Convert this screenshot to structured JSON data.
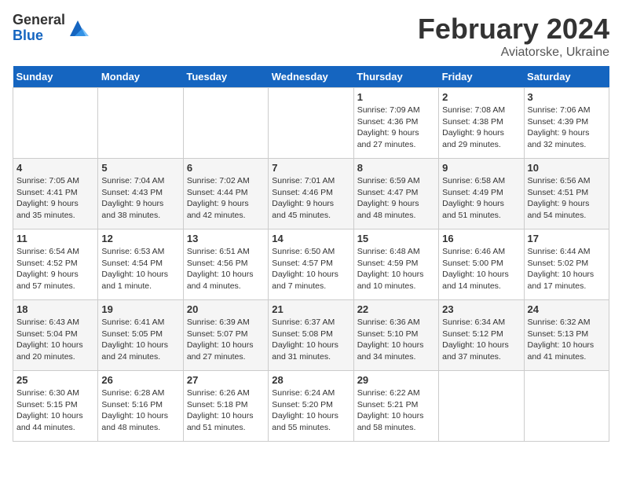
{
  "logo": {
    "general": "General",
    "blue": "Blue"
  },
  "header": {
    "title": "February 2024",
    "subtitle": "Aviatorske, Ukraine"
  },
  "weekdays": [
    "Sunday",
    "Monday",
    "Tuesday",
    "Wednesday",
    "Thursday",
    "Friday",
    "Saturday"
  ],
  "weeks": [
    [
      {
        "day": "",
        "info": ""
      },
      {
        "day": "",
        "info": ""
      },
      {
        "day": "",
        "info": ""
      },
      {
        "day": "",
        "info": ""
      },
      {
        "day": "1",
        "info": "Sunrise: 7:09 AM\nSunset: 4:36 PM\nDaylight: 9 hours\nand 27 minutes."
      },
      {
        "day": "2",
        "info": "Sunrise: 7:08 AM\nSunset: 4:38 PM\nDaylight: 9 hours\nand 29 minutes."
      },
      {
        "day": "3",
        "info": "Sunrise: 7:06 AM\nSunset: 4:39 PM\nDaylight: 9 hours\nand 32 minutes."
      }
    ],
    [
      {
        "day": "4",
        "info": "Sunrise: 7:05 AM\nSunset: 4:41 PM\nDaylight: 9 hours\nand 35 minutes."
      },
      {
        "day": "5",
        "info": "Sunrise: 7:04 AM\nSunset: 4:43 PM\nDaylight: 9 hours\nand 38 minutes."
      },
      {
        "day": "6",
        "info": "Sunrise: 7:02 AM\nSunset: 4:44 PM\nDaylight: 9 hours\nand 42 minutes."
      },
      {
        "day": "7",
        "info": "Sunrise: 7:01 AM\nSunset: 4:46 PM\nDaylight: 9 hours\nand 45 minutes."
      },
      {
        "day": "8",
        "info": "Sunrise: 6:59 AM\nSunset: 4:47 PM\nDaylight: 9 hours\nand 48 minutes."
      },
      {
        "day": "9",
        "info": "Sunrise: 6:58 AM\nSunset: 4:49 PM\nDaylight: 9 hours\nand 51 minutes."
      },
      {
        "day": "10",
        "info": "Sunrise: 6:56 AM\nSunset: 4:51 PM\nDaylight: 9 hours\nand 54 minutes."
      }
    ],
    [
      {
        "day": "11",
        "info": "Sunrise: 6:54 AM\nSunset: 4:52 PM\nDaylight: 9 hours\nand 57 minutes."
      },
      {
        "day": "12",
        "info": "Sunrise: 6:53 AM\nSunset: 4:54 PM\nDaylight: 10 hours\nand 1 minute."
      },
      {
        "day": "13",
        "info": "Sunrise: 6:51 AM\nSunset: 4:56 PM\nDaylight: 10 hours\nand 4 minutes."
      },
      {
        "day": "14",
        "info": "Sunrise: 6:50 AM\nSunset: 4:57 PM\nDaylight: 10 hours\nand 7 minutes."
      },
      {
        "day": "15",
        "info": "Sunrise: 6:48 AM\nSunset: 4:59 PM\nDaylight: 10 hours\nand 10 minutes."
      },
      {
        "day": "16",
        "info": "Sunrise: 6:46 AM\nSunset: 5:00 PM\nDaylight: 10 hours\nand 14 minutes."
      },
      {
        "day": "17",
        "info": "Sunrise: 6:44 AM\nSunset: 5:02 PM\nDaylight: 10 hours\nand 17 minutes."
      }
    ],
    [
      {
        "day": "18",
        "info": "Sunrise: 6:43 AM\nSunset: 5:04 PM\nDaylight: 10 hours\nand 20 minutes."
      },
      {
        "day": "19",
        "info": "Sunrise: 6:41 AM\nSunset: 5:05 PM\nDaylight: 10 hours\nand 24 minutes."
      },
      {
        "day": "20",
        "info": "Sunrise: 6:39 AM\nSunset: 5:07 PM\nDaylight: 10 hours\nand 27 minutes."
      },
      {
        "day": "21",
        "info": "Sunrise: 6:37 AM\nSunset: 5:08 PM\nDaylight: 10 hours\nand 31 minutes."
      },
      {
        "day": "22",
        "info": "Sunrise: 6:36 AM\nSunset: 5:10 PM\nDaylight: 10 hours\nand 34 minutes."
      },
      {
        "day": "23",
        "info": "Sunrise: 6:34 AM\nSunset: 5:12 PM\nDaylight: 10 hours\nand 37 minutes."
      },
      {
        "day": "24",
        "info": "Sunrise: 6:32 AM\nSunset: 5:13 PM\nDaylight: 10 hours\nand 41 minutes."
      }
    ],
    [
      {
        "day": "25",
        "info": "Sunrise: 6:30 AM\nSunset: 5:15 PM\nDaylight: 10 hours\nand 44 minutes."
      },
      {
        "day": "26",
        "info": "Sunrise: 6:28 AM\nSunset: 5:16 PM\nDaylight: 10 hours\nand 48 minutes."
      },
      {
        "day": "27",
        "info": "Sunrise: 6:26 AM\nSunset: 5:18 PM\nDaylight: 10 hours\nand 51 minutes."
      },
      {
        "day": "28",
        "info": "Sunrise: 6:24 AM\nSunset: 5:20 PM\nDaylight: 10 hours\nand 55 minutes."
      },
      {
        "day": "29",
        "info": "Sunrise: 6:22 AM\nSunset: 5:21 PM\nDaylight: 10 hours\nand 58 minutes."
      },
      {
        "day": "",
        "info": ""
      },
      {
        "day": "",
        "info": ""
      }
    ]
  ]
}
